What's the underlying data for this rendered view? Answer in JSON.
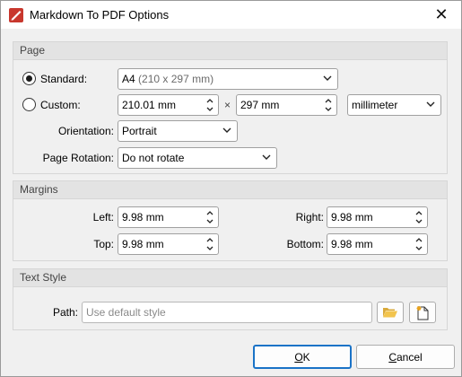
{
  "window": {
    "title": "Markdown To PDF Options",
    "close_glyph": "✕"
  },
  "page_group": {
    "header": "Page",
    "standard": {
      "label": "Standard:",
      "selected": true,
      "value_main": "A4",
      "value_detail": "(210 x 297 mm)"
    },
    "custom": {
      "label": "Custom:",
      "selected": false,
      "width": "210.01 mm",
      "separator": "×",
      "height": "297 mm",
      "unit": "millimeter"
    },
    "orientation": {
      "label": "Orientation:",
      "value": "Portrait"
    },
    "rotation": {
      "label": "Page Rotation:",
      "value": "Do not rotate"
    }
  },
  "margins_group": {
    "header": "Margins",
    "left": {
      "label": "Left:",
      "value": "9.98 mm"
    },
    "right": {
      "label": "Right:",
      "value": "9.98 mm"
    },
    "top": {
      "label": "Top:",
      "value": "9.98 mm"
    },
    "bottom": {
      "label": "Bottom:",
      "value": "9.98 mm"
    }
  },
  "textstyle_group": {
    "header": "Text Style",
    "path_label": "Path:",
    "path_placeholder": "Use default style",
    "browse_icon": "folder-open-icon",
    "new_icon": "new-document-icon"
  },
  "buttons": {
    "ok": {
      "mnemonic": "O",
      "rest": "K"
    },
    "cancel": {
      "mnemonic": "C",
      "rest": "ancel"
    }
  },
  "colors": {
    "accent": "#1a73c7",
    "group_header": "#e3e3e3",
    "app_icon": "#c8372d"
  }
}
